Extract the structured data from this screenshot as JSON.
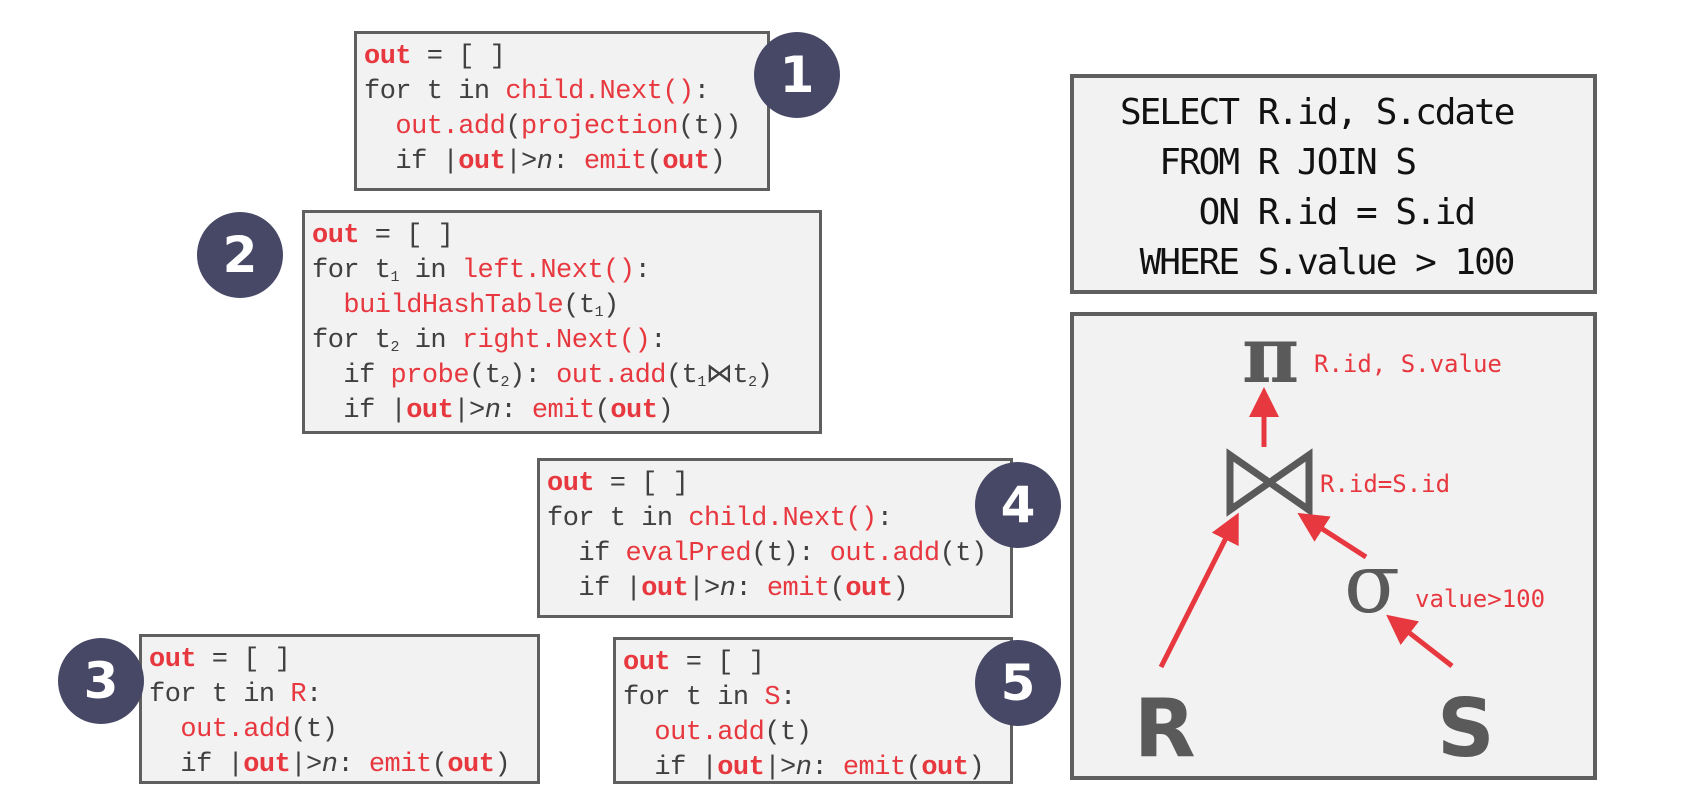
{
  "colors": {
    "accent": "#e8383f",
    "badge": "#474866",
    "box_bg": "#f2f2f2",
    "border": "#5f5f5f",
    "text": "#404040"
  },
  "operators": [
    {
      "badge": "1",
      "name": "projection",
      "lines": [
        [
          {
            "t": "out",
            "c": "r"
          },
          {
            "t": " = [ ]",
            "c": "kw"
          }
        ],
        [
          {
            "t": "for t in ",
            "c": "kw"
          },
          {
            "t": "child.Next()",
            "c": "rn"
          },
          {
            "t": ":",
            "c": "kw"
          }
        ],
        [
          {
            "t": "  ",
            "c": "kw"
          },
          {
            "t": "out.add",
            "c": "rn"
          },
          {
            "t": "(",
            "c": "kw"
          },
          {
            "t": "projection",
            "c": "rn"
          },
          {
            "t": "(t))",
            "c": "kw"
          }
        ],
        [
          {
            "t": "  if |",
            "c": "kw"
          },
          {
            "t": "out",
            "c": "r"
          },
          {
            "t": "|>",
            "c": "kw"
          },
          {
            "t": "n",
            "c": "it"
          },
          {
            "t": ": ",
            "c": "kw"
          },
          {
            "t": "emit",
            "c": "rn"
          },
          {
            "t": "(",
            "c": "kw"
          },
          {
            "t": "out",
            "c": "r"
          },
          {
            "t": ")",
            "c": "kw"
          }
        ]
      ]
    },
    {
      "badge": "2",
      "name": "hash-join",
      "lines": [
        [
          {
            "t": "out",
            "c": "r"
          },
          {
            "t": " = [ ]",
            "c": "kw"
          }
        ],
        [
          {
            "t": "for t",
            "c": "kw"
          },
          {
            "t": "1",
            "c": "sub"
          },
          {
            "t": " in ",
            "c": "kw"
          },
          {
            "t": "left.Next()",
            "c": "rn"
          },
          {
            "t": ":",
            "c": "kw"
          }
        ],
        [
          {
            "t": "  ",
            "c": "kw"
          },
          {
            "t": "buildHashTable",
            "c": "rn"
          },
          {
            "t": "(t",
            "c": "kw"
          },
          {
            "t": "1",
            "c": "sub"
          },
          {
            "t": ")",
            "c": "kw"
          }
        ],
        [
          {
            "t": "for t",
            "c": "kw"
          },
          {
            "t": "2",
            "c": "sub"
          },
          {
            "t": " in ",
            "c": "kw"
          },
          {
            "t": "right.Next()",
            "c": "rn"
          },
          {
            "t": ":",
            "c": "kw"
          }
        ],
        [
          {
            "t": "  if ",
            "c": "kw"
          },
          {
            "t": "probe",
            "c": "rn"
          },
          {
            "t": "(t",
            "c": "kw"
          },
          {
            "t": "2",
            "c": "sub"
          },
          {
            "t": "): ",
            "c": "kw"
          },
          {
            "t": "out.add",
            "c": "rn"
          },
          {
            "t": "(t",
            "c": "kw"
          },
          {
            "t": "1",
            "c": "sub"
          },
          {
            "t": "⋈t",
            "c": "kw"
          },
          {
            "t": "2",
            "c": "sub"
          },
          {
            "t": ")",
            "c": "kw"
          }
        ],
        [
          {
            "t": "  if |",
            "c": "kw"
          },
          {
            "t": "out",
            "c": "r"
          },
          {
            "t": "|>",
            "c": "kw"
          },
          {
            "t": "n",
            "c": "it"
          },
          {
            "t": ": ",
            "c": "kw"
          },
          {
            "t": "emit",
            "c": "rn"
          },
          {
            "t": "(",
            "c": "kw"
          },
          {
            "t": "out",
            "c": "r"
          },
          {
            "t": ")",
            "c": "kw"
          }
        ]
      ]
    },
    {
      "badge": "3",
      "name": "scan-r",
      "lines": [
        [
          {
            "t": "out",
            "c": "r"
          },
          {
            "t": " = [ ]",
            "c": "kw"
          }
        ],
        [
          {
            "t": "for t in ",
            "c": "kw"
          },
          {
            "t": "R",
            "c": "rn"
          },
          {
            "t": ":",
            "c": "kw"
          }
        ],
        [
          {
            "t": "  ",
            "c": "kw"
          },
          {
            "t": "out.add",
            "c": "rn"
          },
          {
            "t": "(t)",
            "c": "kw"
          }
        ],
        [
          {
            "t": "  if |",
            "c": "kw"
          },
          {
            "t": "out",
            "c": "r"
          },
          {
            "t": "|>",
            "c": "kw"
          },
          {
            "t": "n",
            "c": "it"
          },
          {
            "t": ": ",
            "c": "kw"
          },
          {
            "t": "emit",
            "c": "rn"
          },
          {
            "t": "(",
            "c": "kw"
          },
          {
            "t": "out",
            "c": "r"
          },
          {
            "t": ")",
            "c": "kw"
          }
        ]
      ]
    },
    {
      "badge": "4",
      "name": "selection",
      "lines": [
        [
          {
            "t": "out",
            "c": "r"
          },
          {
            "t": " = [ ]",
            "c": "kw"
          }
        ],
        [
          {
            "t": "for t in ",
            "c": "kw"
          },
          {
            "t": "child.Next()",
            "c": "rn"
          },
          {
            "t": ":",
            "c": "kw"
          }
        ],
        [
          {
            "t": "  if ",
            "c": "kw"
          },
          {
            "t": "evalPred",
            "c": "rn"
          },
          {
            "t": "(t): ",
            "c": "kw"
          },
          {
            "t": "out.add",
            "c": "rn"
          },
          {
            "t": "(t)",
            "c": "kw"
          }
        ],
        [
          {
            "t": "  if |",
            "c": "kw"
          },
          {
            "t": "out",
            "c": "r"
          },
          {
            "t": "|>",
            "c": "kw"
          },
          {
            "t": "n",
            "c": "it"
          },
          {
            "t": ": ",
            "c": "kw"
          },
          {
            "t": "emit",
            "c": "rn"
          },
          {
            "t": "(",
            "c": "kw"
          },
          {
            "t": "out",
            "c": "r"
          },
          {
            "t": ")",
            "c": "kw"
          }
        ]
      ]
    },
    {
      "badge": "5",
      "name": "scan-s",
      "lines": [
        [
          {
            "t": "out",
            "c": "r"
          },
          {
            "t": " = [ ]",
            "c": "kw"
          }
        ],
        [
          {
            "t": "for t in ",
            "c": "kw"
          },
          {
            "t": "S",
            "c": "rn"
          },
          {
            "t": ":",
            "c": "kw"
          }
        ],
        [
          {
            "t": "  ",
            "c": "kw"
          },
          {
            "t": "out.add",
            "c": "rn"
          },
          {
            "t": "(t)",
            "c": "kw"
          }
        ],
        [
          {
            "t": "  if |",
            "c": "kw"
          },
          {
            "t": "out",
            "c": "r"
          },
          {
            "t": "|>",
            "c": "kw"
          },
          {
            "t": "n",
            "c": "it"
          },
          {
            "t": ": ",
            "c": "kw"
          },
          {
            "t": "emit",
            "c": "rn"
          },
          {
            "t": "(",
            "c": "kw"
          },
          {
            "t": "out",
            "c": "r"
          },
          {
            "t": ")",
            "c": "kw"
          }
        ]
      ]
    }
  ],
  "sql": {
    "lines": [
      {
        "keyword": "SELECT",
        "rest": "R.id, S.cdate"
      },
      {
        "keyword": "FROM",
        "rest": "R JOIN S"
      },
      {
        "keyword": "ON",
        "rest": "R.id = S.id"
      },
      {
        "keyword": "WHERE",
        "rest": "S.value > 100"
      }
    ]
  },
  "plan": {
    "projection": {
      "symbol": "π",
      "label": "R.id, S.value"
    },
    "join": {
      "symbol": "⋈",
      "label": "R.id=S.id"
    },
    "selection": {
      "symbol": "σ",
      "label": "value>100"
    },
    "left_relation": "R",
    "right_relation": "S"
  }
}
